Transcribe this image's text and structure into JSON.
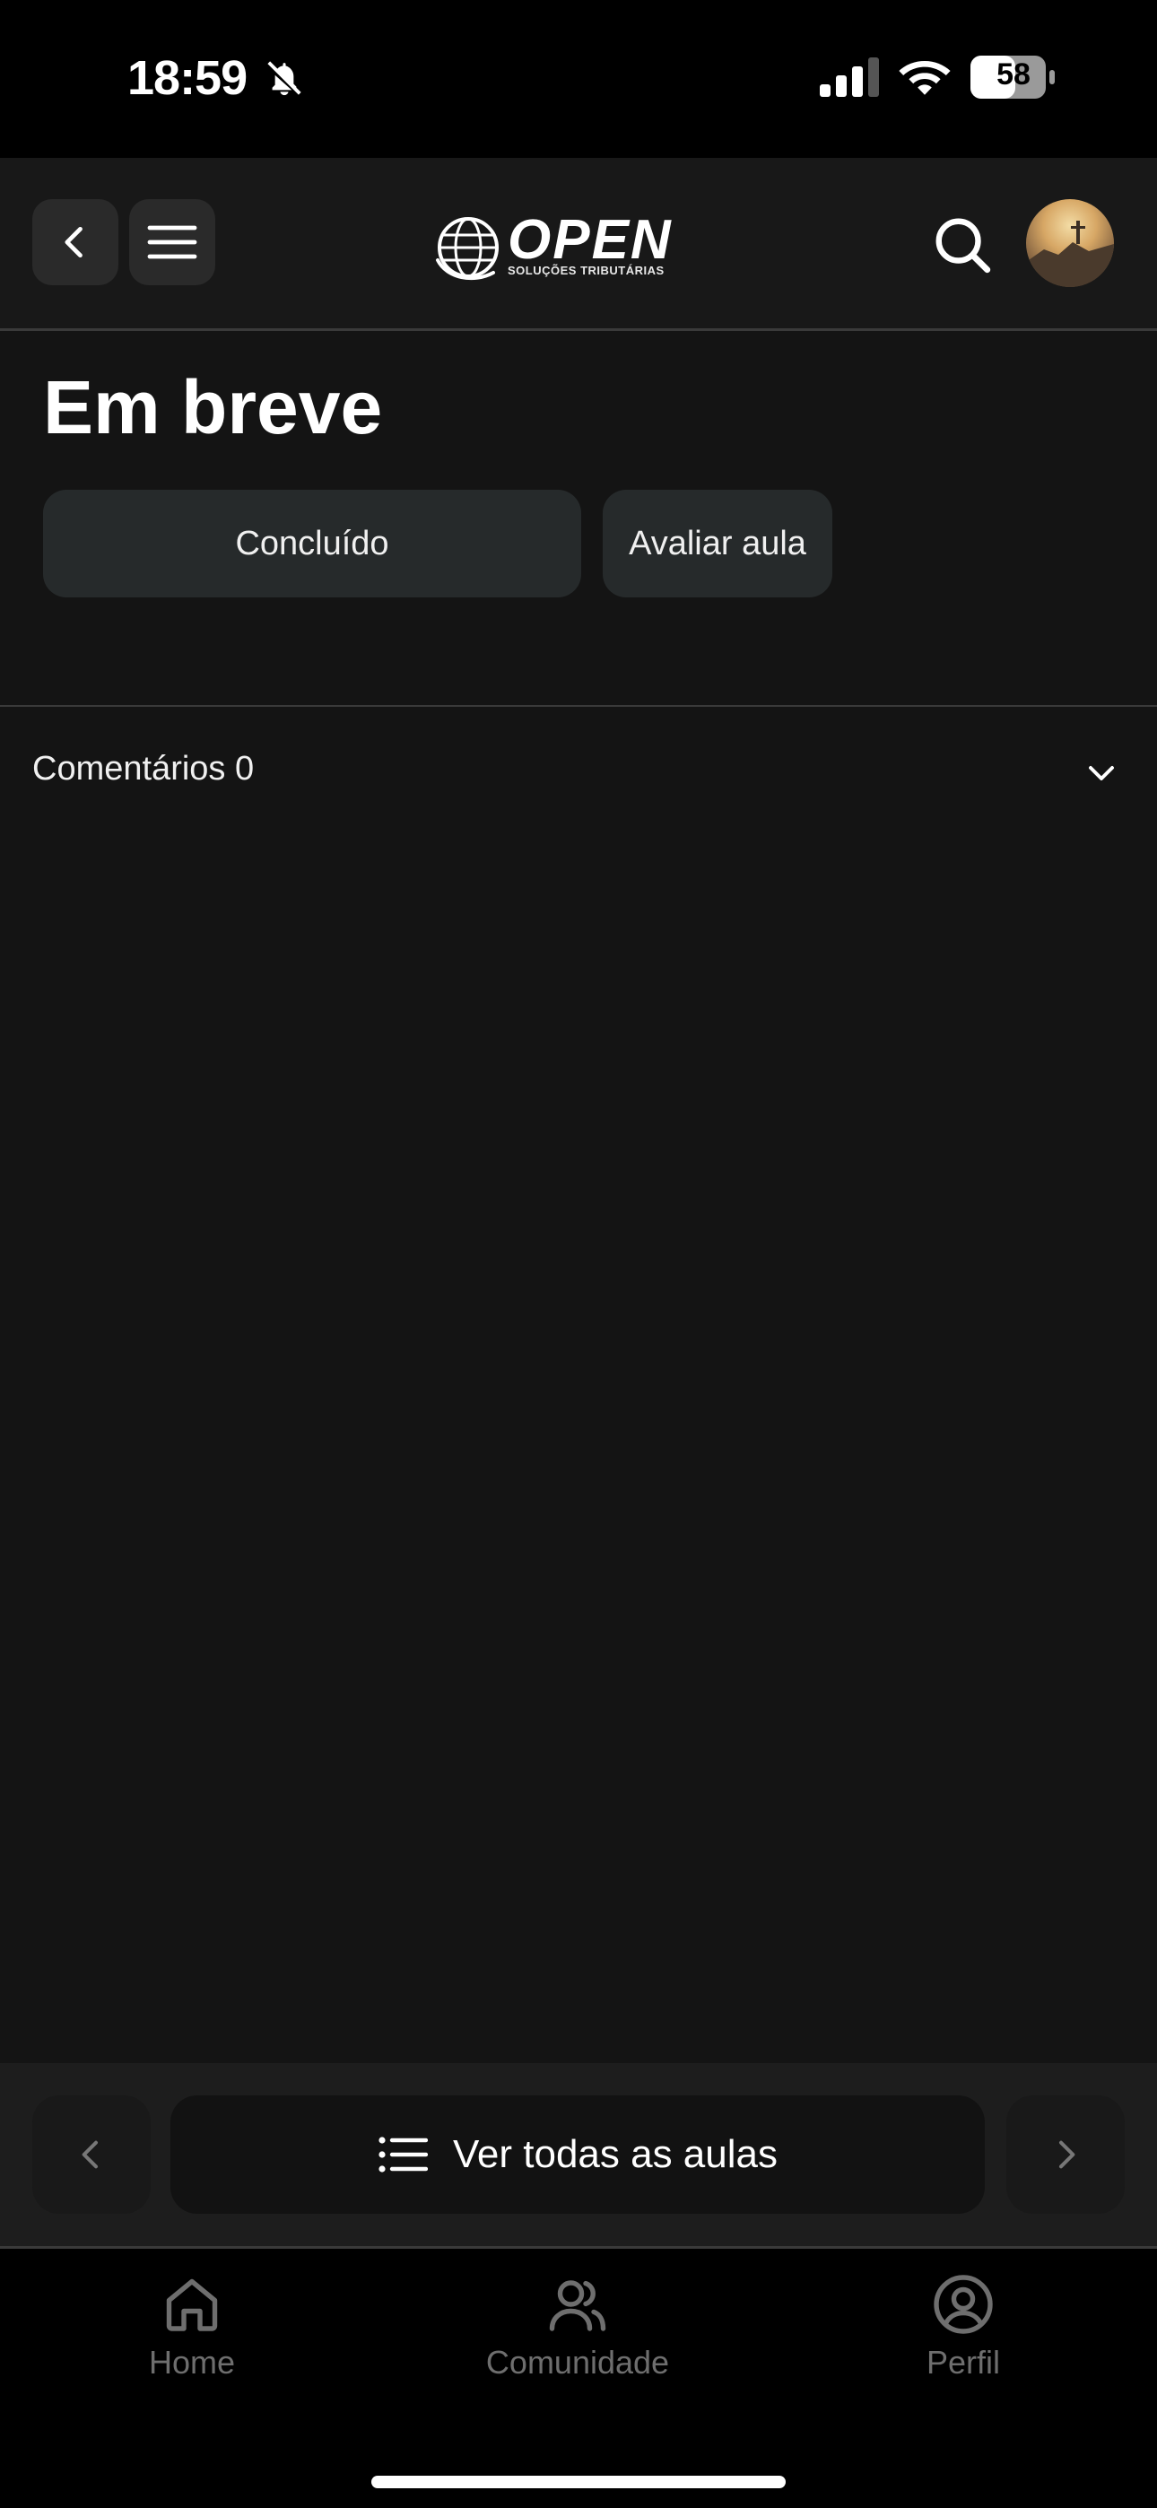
{
  "status_bar": {
    "time": "18:59",
    "battery": "58",
    "icons": [
      "bell-slash-icon",
      "cellular-signal-icon",
      "wifi-icon",
      "battery-icon"
    ]
  },
  "header": {
    "logo_text": "OPEN",
    "logo_subtext": "SOLUÇÕES TRIBUTÁRIAS",
    "icons": [
      "chevron-left-icon",
      "hamburger-menu-icon",
      "search-icon",
      "avatar"
    ]
  },
  "lesson": {
    "title": "Em breve",
    "complete_label": "Concluído",
    "rate_label": "Avaliar aula"
  },
  "comments": {
    "label": "Comentários 0"
  },
  "lesson_nav": {
    "all_lessons_label": "Ver todas as aulas"
  },
  "tab_bar": {
    "items": [
      {
        "label": "Home",
        "icon": "home-icon"
      },
      {
        "label": "Comunidade",
        "icon": "users-icon"
      },
      {
        "label": "Perfil",
        "icon": "user-circle-icon"
      }
    ]
  },
  "colors": {
    "background": "#141414",
    "header_bg": "#181818",
    "pill_bg": "#262a2b",
    "tab_inactive": "#6e6e6e"
  }
}
